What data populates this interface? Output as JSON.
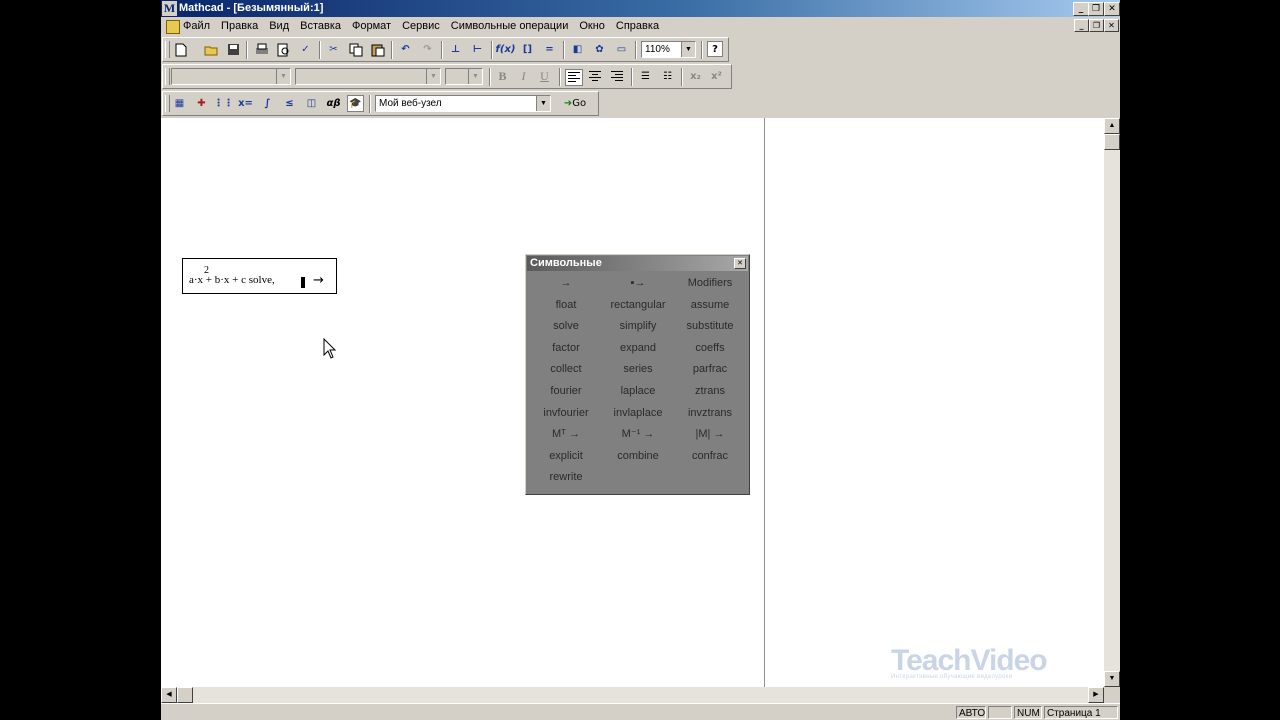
{
  "window": {
    "title": "Mathcad - [Безымянный:1]",
    "logo_letter": "M",
    "controls": [
      "_",
      "❐",
      "✕"
    ]
  },
  "menubar": {
    "items": [
      "Файл",
      "Правка",
      "Вид",
      "Вставка",
      "Формат",
      "Сервис",
      "Символьные операции",
      "Окно",
      "Справка"
    ],
    "doc_controls": [
      "_",
      "❐",
      "✕"
    ]
  },
  "toolbar_standard": {
    "zoom": "110%",
    "help_glyph": "?"
  },
  "toolbar_format": {
    "style_value": "",
    "font_value": "",
    "size_value": "",
    "bold": "B",
    "italic": "I",
    "underline": "U"
  },
  "toolbar_math": {
    "web_combo_value": "Мой веб-узел",
    "go_label": "Go"
  },
  "math_region": {
    "expression": "a·x   + b·x + c solve,",
    "exponent": "2",
    "arrow": "→"
  },
  "symbolic_palette": {
    "title": "Символьные",
    "close": "✕",
    "items": [
      "→",
      "▪→",
      "Modifiers",
      "float",
      "rectangular",
      "assume",
      "solve",
      "simplify",
      "substitute",
      "factor",
      "expand",
      "coeffs",
      "collect",
      "series",
      "parfrac",
      "fourier",
      "laplace",
      "ztrans",
      "invfourier",
      "invlaplace",
      "invztrans",
      "Mᵀ →",
      "M⁻¹ →",
      "|M| →",
      "explicit",
      "combine",
      "confrac",
      "rewrite"
    ]
  },
  "statusbar": {
    "mode": "АВТО",
    "num": "NUM",
    "page": "Страница 1"
  },
  "watermark": {
    "brand": "TeachVideo",
    "tagline": "Интерактивные обучающие видеоуроки"
  }
}
